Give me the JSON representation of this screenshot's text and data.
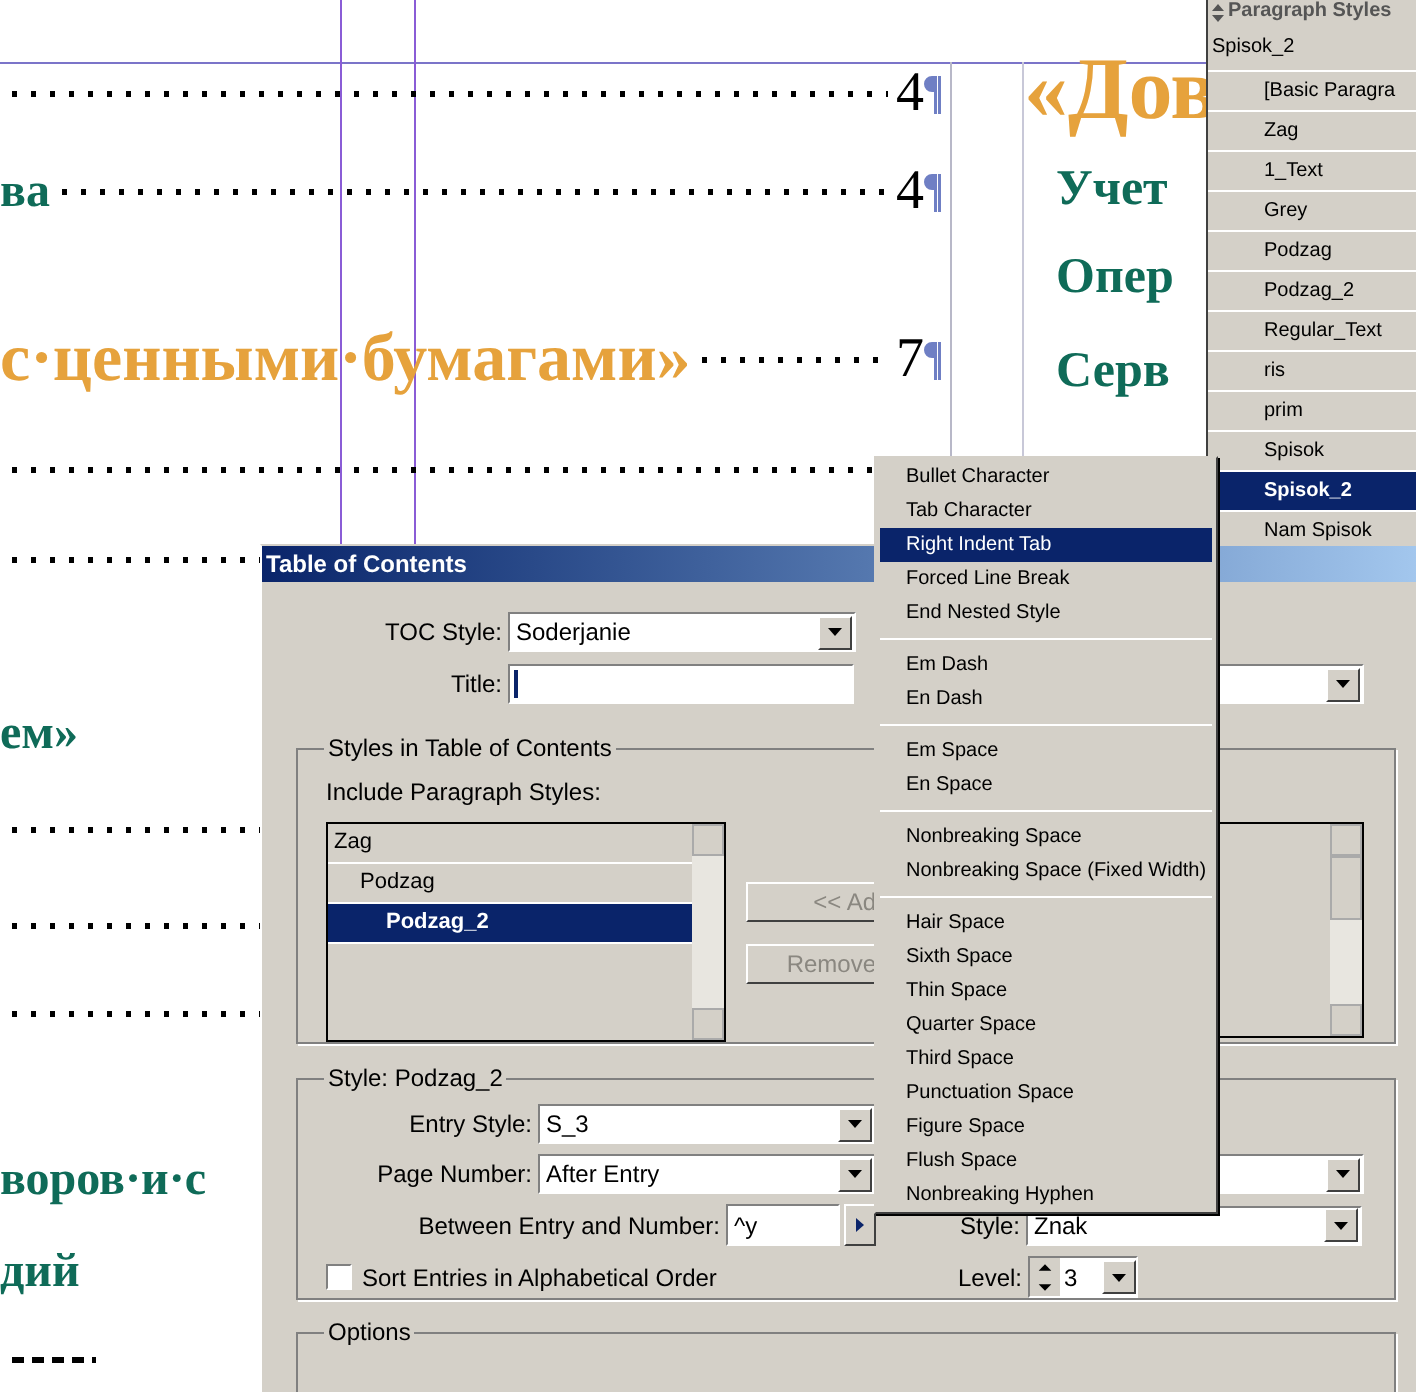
{
  "document": {
    "left_lines": [
      {
        "kind": "leader",
        "number": "4"
      },
      {
        "kind": "entry",
        "text": "ва",
        "number": "4"
      },
      {
        "kind": "heading",
        "text": "с·ценными·бумагами»",
        "number": "7"
      },
      {
        "kind": "leader"
      },
      {
        "kind": "leader"
      },
      {
        "kind": "entry",
        "text": "ем»"
      },
      {
        "kind": "leader"
      },
      {
        "kind": "leader"
      },
      {
        "kind": "leader"
      },
      {
        "kind": "entry",
        "text": "воров·и·с"
      },
      {
        "kind": "entry",
        "text": "дий"
      },
      {
        "kind": "dashes"
      }
    ],
    "right_lines": [
      {
        "kind": "heading",
        "text": "«Дов"
      },
      {
        "kind": "entry",
        "text": "Учет"
      },
      {
        "kind": "entry",
        "text": "Опер"
      },
      {
        "kind": "entry",
        "text": "Серв"
      }
    ]
  },
  "paragraph_styles": {
    "title": "Paragraph Styles",
    "current": "Spisok_2",
    "items": [
      {
        "label": "[Basic Paragra",
        "selected": false
      },
      {
        "label": "Zag",
        "selected": false
      },
      {
        "label": "1_Text",
        "selected": false
      },
      {
        "label": "Grey",
        "selected": false
      },
      {
        "label": "Podzag",
        "selected": false
      },
      {
        "label": "Podzag_2",
        "selected": false
      },
      {
        "label": "Regular_Text",
        "selected": false
      },
      {
        "label": "ris",
        "selected": false
      },
      {
        "label": "prim",
        "selected": false
      },
      {
        "label": "Spisok",
        "selected": false
      },
      {
        "label": "Spisok_2",
        "selected": true
      },
      {
        "label": "Nam Spisok",
        "selected": false
      }
    ]
  },
  "dialog": {
    "title": "Table of Contents",
    "toc_style": {
      "label": "TOC Style:",
      "value": "Soderjanie"
    },
    "title_field": {
      "label": "Title:"
    },
    "styles_group": {
      "title": "Styles in Table of Contents",
      "include_label": "Include Paragraph Styles:",
      "styles": [
        {
          "label": "Zag",
          "selected": false,
          "children": [
            {
              "label": "Podzag",
              "selected": false,
              "children": [
                {
                  "label": "Podzag_2",
                  "selected": true
                }
              ]
            }
          ]
        }
      ],
      "buttons": [
        {
          "label": "<< Ad",
          "disabled": true
        },
        {
          "label": "Remove",
          "disabled": true
        }
      ]
    },
    "style_group": {
      "title": "Style: Podzag_2",
      "entry_style": {
        "label": "Entry Style:",
        "value": "S_3"
      },
      "page_number": {
        "label": "Page Number:",
        "value": "After Entry"
      },
      "between": {
        "label": "Between Entry and Number:",
        "value": "^y"
      },
      "sort": {
        "label": "Sort Entries in Alphabetical Order",
        "checked": false
      },
      "style": {
        "label": "Style:",
        "value": "Znak"
      },
      "level": {
        "label": "Level:",
        "value": "3"
      }
    },
    "options_group": {
      "title": "Options"
    }
  },
  "menu": {
    "groups": [
      {
        "items": [
          {
            "label": "Bullet Character",
            "selected": false
          },
          {
            "label": "Tab Character",
            "selected": false
          },
          {
            "label": "Right Indent Tab",
            "selected": true
          },
          {
            "label": "Forced Line Break",
            "selected": false
          },
          {
            "label": "End Nested Style",
            "selected": false
          }
        ]
      },
      {
        "items": [
          {
            "label": "Em Dash",
            "selected": false
          },
          {
            "label": "En Dash",
            "selected": false
          }
        ]
      },
      {
        "items": [
          {
            "label": "Em Space",
            "selected": false
          },
          {
            "label": "En Space",
            "selected": false
          }
        ]
      },
      {
        "items": [
          {
            "label": "Nonbreaking Space",
            "selected": false
          },
          {
            "label": "Nonbreaking Space (Fixed Width)",
            "selected": false
          }
        ]
      },
      {
        "items": [
          {
            "label": "Hair Space",
            "selected": false
          },
          {
            "label": "Sixth Space",
            "selected": false
          },
          {
            "label": "Thin Space",
            "selected": false
          },
          {
            "label": "Quarter Space",
            "selected": false
          },
          {
            "label": "Third Space",
            "selected": false
          },
          {
            "label": "Punctuation Space",
            "selected": false
          },
          {
            "label": "Figure Space",
            "selected": false
          },
          {
            "label": "Flush Space",
            "selected": false
          },
          {
            "label": "Nonbreaking Hyphen",
            "selected": false
          }
        ]
      }
    ]
  }
}
